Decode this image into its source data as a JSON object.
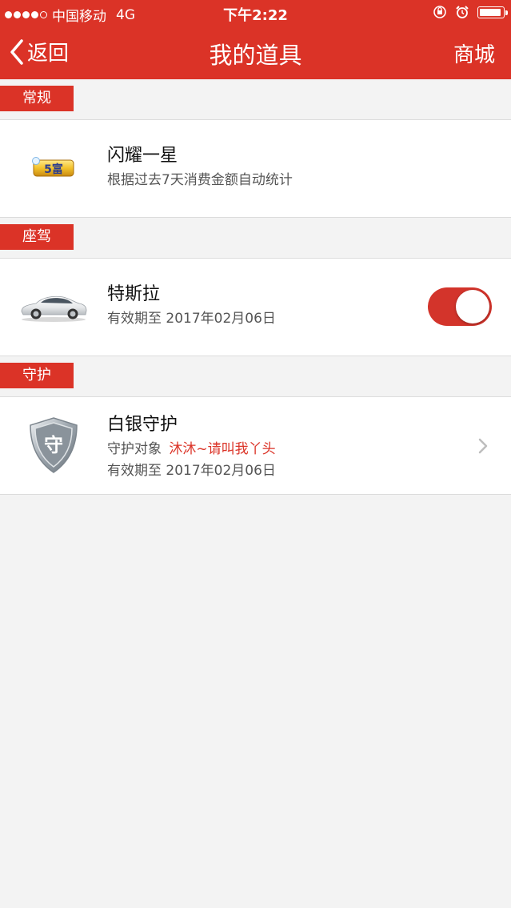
{
  "status_bar": {
    "carrier": "中国移动",
    "network": "4G",
    "time": "下午2:22",
    "signal_filled": 4,
    "signal_total": 5
  },
  "nav": {
    "back_label": "返回",
    "title": "我的道具",
    "shop_label": "商城"
  },
  "sections": [
    {
      "tag": "常规",
      "item": {
        "icon": "badge-5-fortune-icon",
        "badge_text": "5富",
        "title": "闪耀一星",
        "subtitle": "根据过去7天消费金额自动统计"
      }
    },
    {
      "tag": "座驾",
      "item": {
        "icon": "car-icon",
        "title": "特斯拉",
        "subtitle": "有效期至 2017年02月06日",
        "toggle_on": true
      }
    },
    {
      "tag": "守护",
      "item": {
        "icon": "silver-shield-icon",
        "shield_text": "守",
        "title": "白银守护",
        "target_label": "守护对象",
        "target_name": "沐沐~请叫我丫头",
        "subtitle": "有效期至 2017年02月06日"
      }
    }
  ],
  "colors": {
    "brand": "#db3327",
    "background": "#f3f3f3",
    "highlight": "#db3327"
  }
}
